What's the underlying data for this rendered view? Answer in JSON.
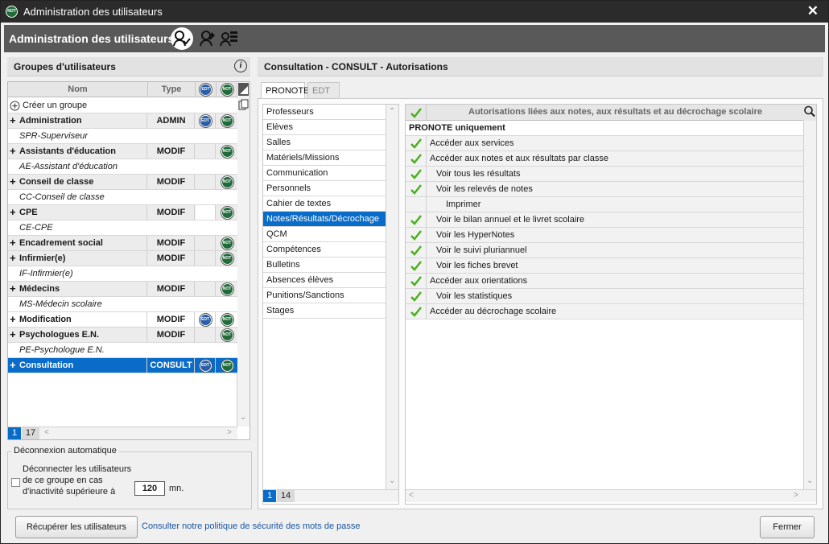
{
  "window": {
    "title": "Administration des utilisateurs",
    "app_badge": "NOT"
  },
  "header": {
    "title": "Administration des utilisateurs",
    "icons": [
      "user-check-icon",
      "user-edit-icon",
      "user-list-icon"
    ]
  },
  "groups_panel": {
    "title": "Groupes d'utilisateurs",
    "columns": {
      "name": "Nom",
      "type": "Type",
      "edt": "EDT",
      "not": "NOT"
    },
    "create_label": "Créer un groupe",
    "rows": [
      {
        "kind": "group",
        "name": "Administration",
        "type": "ADMIN",
        "edt": true,
        "not": true
      },
      {
        "kind": "sub",
        "name": "SPR-Superviseur"
      },
      {
        "kind": "group",
        "name": "Assistants d'éducation",
        "type": "MODIF",
        "edt": false,
        "not": true
      },
      {
        "kind": "sub",
        "name": "AE-Assistant d'éducation"
      },
      {
        "kind": "group",
        "name": "Conseil de classe",
        "type": "MODIF",
        "edt": false,
        "not": true
      },
      {
        "kind": "sub",
        "name": "CC-Conseil de classe"
      },
      {
        "kind": "group",
        "name": "CPE",
        "type": "MODIF",
        "edt": false,
        "not": true,
        "white_edt": true
      },
      {
        "kind": "sub",
        "name": "CE-CPE"
      },
      {
        "kind": "group",
        "name": "Encadrement social",
        "type": "MODIF",
        "edt": false,
        "not": true
      },
      {
        "kind": "group",
        "name": "Infirmier(e)",
        "type": "MODIF",
        "edt": false,
        "not": true
      },
      {
        "kind": "sub",
        "name": "IF-Infirmier(e)"
      },
      {
        "kind": "group",
        "name": "Médecins",
        "type": "MODIF",
        "edt": false,
        "not": true
      },
      {
        "kind": "sub",
        "name": "MS-Médecin scolaire"
      },
      {
        "kind": "group",
        "name": "Modification",
        "type": "MODIF",
        "edt": true,
        "not": true,
        "white": true
      },
      {
        "kind": "group",
        "name": "Psychologues E.N.",
        "type": "MODIF",
        "edt": false,
        "not": true
      },
      {
        "kind": "sub",
        "name": "PE-Psychologue E.N."
      },
      {
        "kind": "group",
        "name": "Consultation",
        "type": "CONSULT",
        "edt": true,
        "not": true,
        "selected": true
      }
    ],
    "pager": {
      "current": "1",
      "total": "17"
    }
  },
  "auto_logout": {
    "legend": "Déconnexion automatique",
    "line1": "Déconnecter les utilisateurs",
    "line2": "de ce groupe en cas",
    "line3": "d'inactivité supérieure à",
    "value": "120",
    "unit": "mn."
  },
  "right_panel": {
    "title": "Consultation - CONSULT - Autorisations",
    "tabs": [
      "PRONOTE",
      "EDT"
    ],
    "active_tab": "PRONOTE",
    "categories": [
      "Professeurs",
      "Elèves",
      "Salles",
      "Matériels/Missions",
      "Communication",
      "Personnels",
      "Cahier de textes",
      "Notes/Résultats/Décrochage",
      "QCM",
      "Compétences",
      "Bulletins",
      "Absences élèves",
      "Punitions/Sanctions",
      "Stages"
    ],
    "selected_category": "Notes/Résultats/Décrochage",
    "cat_pager": {
      "current": "1",
      "total": "14"
    },
    "auth_header": "Autorisations liées aux notes, aux résultats et au décrochage scolaire",
    "section_label": "PRONOTE uniquement",
    "permissions": [
      {
        "label": "Accéder aux services",
        "indent": 0,
        "checked": true
      },
      {
        "label": "Accéder aux notes et aux résultats par classe",
        "indent": 0,
        "checked": true
      },
      {
        "label": "Voir tous les résultats",
        "indent": 1,
        "checked": true
      },
      {
        "label": "Voir les relevés de notes",
        "indent": 1,
        "checked": true
      },
      {
        "label": "Imprimer",
        "indent": 2,
        "checked": false
      },
      {
        "label": "Voir le bilan annuel et le livret scolaire",
        "indent": 1,
        "checked": true
      },
      {
        "label": "Voir les HyperNotes",
        "indent": 1,
        "checked": true
      },
      {
        "label": "Voir le suivi pluriannuel",
        "indent": 1,
        "checked": true
      },
      {
        "label": "Voir les fiches brevet",
        "indent": 1,
        "checked": true
      },
      {
        "label": "Accéder aux orientations",
        "indent": 0,
        "checked": true
      },
      {
        "label": "Voir les statistiques",
        "indent": 1,
        "checked": true
      },
      {
        "label": "Accéder au décrochage scolaire",
        "indent": 0,
        "checked": true
      }
    ]
  },
  "footer": {
    "recover_button": "Récupérer les utilisateurs",
    "policy_link": "Consulter notre politique de sécurité des mots de passe",
    "close_button": "Fermer"
  },
  "colors": {
    "accent": "#0a6cc9",
    "check": "#4caf1f",
    "not_badge": "#1f6b3a",
    "edt_badge": "#2a5ea8"
  }
}
